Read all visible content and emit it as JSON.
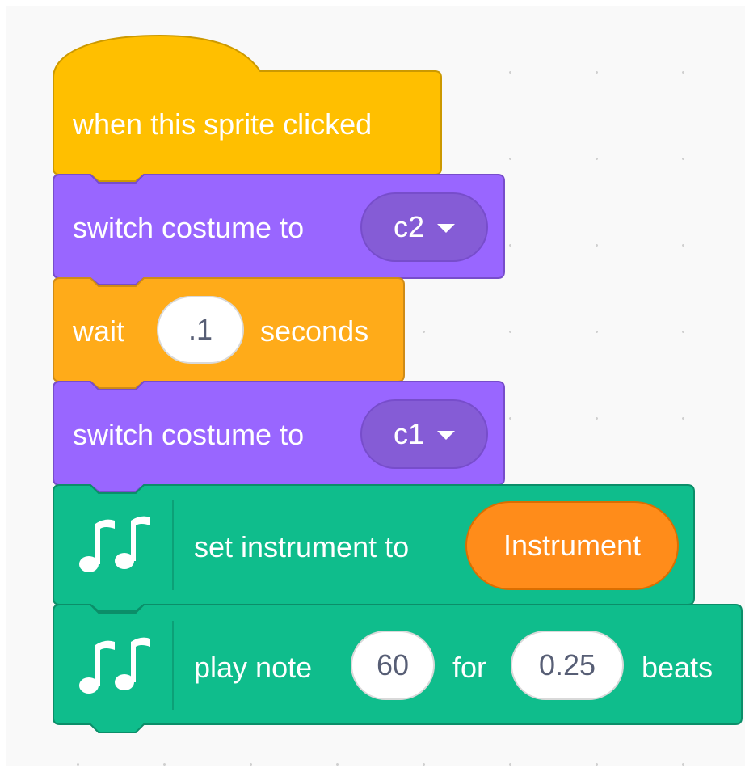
{
  "script": {
    "hat": {
      "label": "when this sprite clicked",
      "color": "#ffbf00"
    },
    "switch1": {
      "label": "switch costume to",
      "value": "c2",
      "color": "#9966ff"
    },
    "wait": {
      "label": "wait",
      "value": ".1",
      "suffix": "seconds",
      "color": "#ffab19"
    },
    "switch2": {
      "label": "switch costume to",
      "value": "c1",
      "color": "#9966ff"
    },
    "instrument": {
      "label": "set instrument to",
      "value": "Instrument",
      "color": "#0fbd8c",
      "icon": "music-notes-icon"
    },
    "play": {
      "label": "play note",
      "note": "60",
      "for_label": "for",
      "beats": "0.25",
      "beats_label": "beats",
      "color": "#0fbd8c",
      "icon": "music-notes-icon"
    }
  }
}
